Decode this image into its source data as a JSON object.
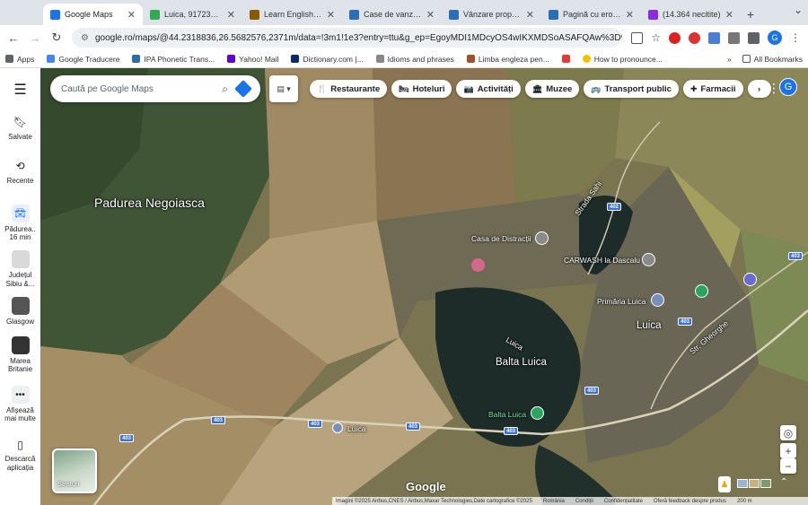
{
  "tabs": [
    {
      "title": "Google Maps",
      "active": true,
      "color": "#1a73e8"
    },
    {
      "title": "Luica, 917235 câte",
      "active": false,
      "color": "#34a853"
    },
    {
      "title": "Learn English Onli",
      "active": false,
      "color": "#8a5a00"
    },
    {
      "title": "Case de vanzare H",
      "active": false,
      "color": "#2a6fb5"
    },
    {
      "title": "Vânzare proprietat",
      "active": false,
      "color": "#2a6fb5"
    },
    {
      "title": "Pagină cu eroare",
      "active": false,
      "color": "#2a6fb5"
    },
    {
      "title": "(14.364 necitite)",
      "active": false,
      "color": "#8a2be2"
    }
  ],
  "address": {
    "url": "google.ro/maps/@44.2318836,26.5682576,2371m/data=!3m1!1e3?entry=ttu&g_ep=EgoyMDI1MDcyOS4wIKXMDSoASAFQAw%3D%3D"
  },
  "bookmarks": {
    "items": [
      {
        "label": "Apps",
        "color": "#5f6368"
      },
      {
        "label": "Google Traducere",
        "color": "#4285f4"
      },
      {
        "label": "IPA Phonetic Trans...",
        "color": "#2b6cb0"
      },
      {
        "label": "Yahoo! Mail",
        "color": "#6001d2"
      },
      {
        "label": "Dictionary.com |...",
        "color": "#0a2a6c"
      },
      {
        "label": "Idioms and phrases",
        "color": "#888888"
      },
      {
        "label": "Limba engleza pen...",
        "color": "#a0522d"
      },
      {
        "label": "",
        "color": "#e53935"
      },
      {
        "label": "How to pronounce...",
        "color": "#f2c200"
      }
    ],
    "more": "»",
    "all": "All Bookmarks"
  },
  "rail": {
    "saved": "Salvate",
    "recent": "Recente",
    "recent_places": [
      {
        "label": "Pădurea.. 16 min",
        "color": "#1a73e8"
      },
      {
        "label": "Județul Sibiu &...",
        "color": "#d9d9d9"
      },
      {
        "label": "Glasgow",
        "color": "#555555"
      },
      {
        "label": "Marea Britanie",
        "color": "#333333"
      }
    ],
    "show_more": "Afișează mai multe",
    "download": "Descarcă aplicația"
  },
  "search": {
    "placeholder": "Caută pe Google Maps"
  },
  "chips": [
    {
      "label": "Restaurante",
      "icon": "🍴"
    },
    {
      "label": "Hoteluri",
      "icon": "🛏"
    },
    {
      "label": "Activități",
      "icon": "📷"
    },
    {
      "label": "Muzee",
      "icon": "🏛"
    },
    {
      "label": "Transport public",
      "icon": "🚌"
    },
    {
      "label": "Farmacii",
      "icon": "✚"
    }
  ],
  "chip_more": "›",
  "avatar_letter": "G",
  "map_labels": {
    "forest": "Padurea Negoiasca",
    "casa": "Casa de Distracții",
    "carwash": "CARWASH la Dascalu",
    "primaria": "Primăria Luica",
    "luica_town": "Luica",
    "str_gheorghe": "Str. Gheorghe",
    "strada_sahi": "Strada Sahi",
    "lake": "Balta Luica",
    "lake_small": "Luica",
    "lake_pin": "Balta Luica",
    "road_luica": "Luica"
  },
  "road_shields": [
    "402",
    "403",
    "403",
    "403",
    "403",
    "403",
    "403",
    "403",
    "403"
  ],
  "straturi": "Straturi",
  "google": "Google",
  "footer": [
    "Imagini ©2025 Airbus,CNES / Airbus,Maxar Technologies,Date cartografice ©2025",
    "România",
    "Condiții",
    "Confidențialitate",
    "Oferă feedback despre produs",
    "200 m"
  ]
}
